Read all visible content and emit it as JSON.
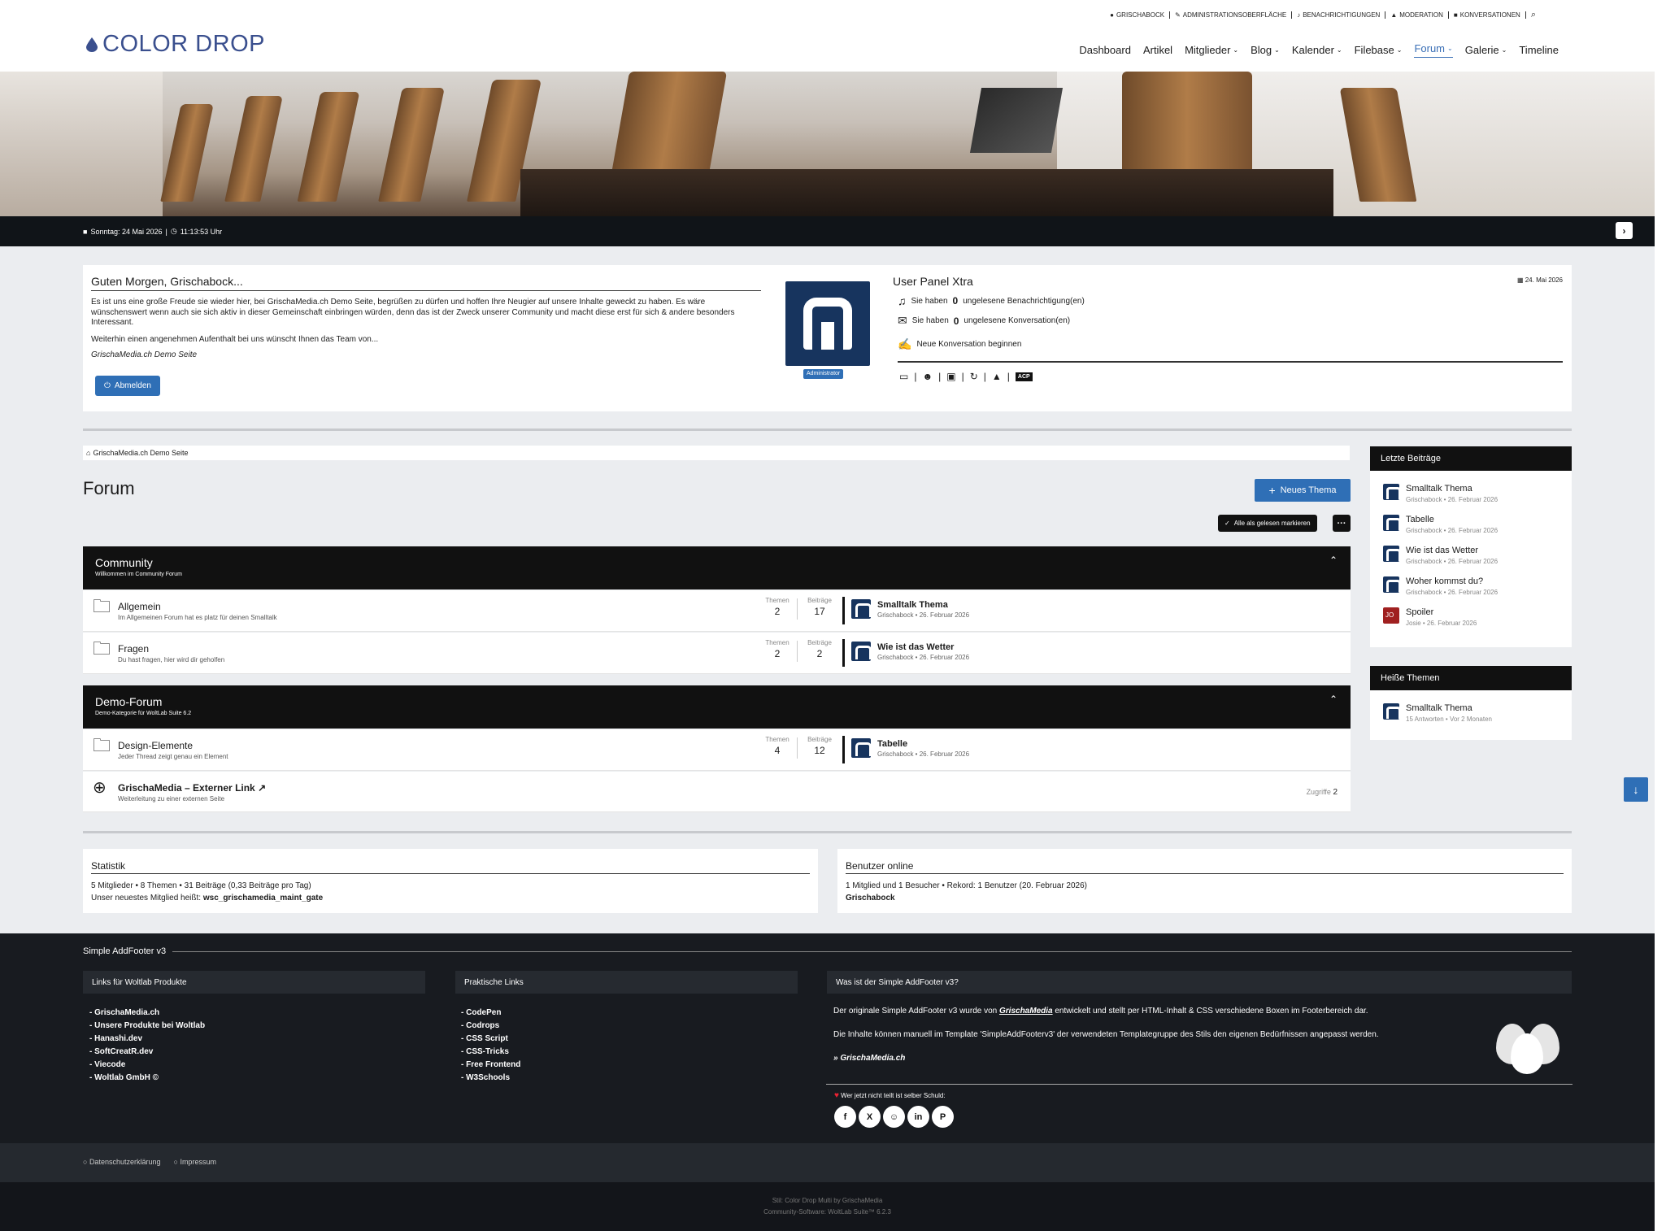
{
  "topbar": {
    "items": [
      "Grischabock",
      "Administrationsoberfläche",
      "Benachrichtigungen",
      "Moderation",
      "Konversationen"
    ]
  },
  "logo": {
    "title": "COLOR DROP"
  },
  "nav": {
    "items": [
      {
        "label": "Dashboard",
        "dropdown": false
      },
      {
        "label": "Artikel",
        "dropdown": false
      },
      {
        "label": "Mitglieder",
        "dropdown": true
      },
      {
        "label": "Blog",
        "dropdown": true
      },
      {
        "label": "Kalender",
        "dropdown": true
      },
      {
        "label": "Filebase",
        "dropdown": true
      },
      {
        "label": "Forum",
        "dropdown": true,
        "active": true
      },
      {
        "label": "Galerie",
        "dropdown": true
      },
      {
        "label": "Timeline",
        "dropdown": false
      }
    ]
  },
  "datebar": {
    "text": "Sonntag: 24 Mai 2026",
    "time": "11:13:53 Uhr"
  },
  "greeting": {
    "title": "Guten Morgen, Grischabock...",
    "p1": "Es ist uns eine große Freude sie wieder hier, bei GrischaMedia.ch Demo Seite, begrüßen zu dürfen und hoffen Ihre Neugier auf unsere Inhalte geweckt zu haben. Es wäre wünschenswert wenn auch sie sich aktiv in dieser Gemeinschaft einbringen würden, denn das ist der Zweck unserer Community und macht diese erst für sich & andere besonders Interessant.",
    "p2": "Weiterhin einen angenehmen Aufenthalt bei uns wünscht Ihnen das Team von...",
    "signature": "GrischaMedia.ch Demo Seite",
    "logout": "Abmelden"
  },
  "avatar": {
    "badge": "Administrator"
  },
  "userpanel": {
    "title": "User Panel Xtra",
    "date": "24. Mai 2026",
    "notifications": {
      "pre": "Sie haben",
      "count": "0",
      "post": "ungelesene Benachrichtigung(en)"
    },
    "conversations": {
      "pre": "Sie haben",
      "count": "0",
      "post": "ungelesene Konversation(en)"
    },
    "new_conversation": "Neue Konversation beginnen",
    "acp": "ACP"
  },
  "breadcrumb": {
    "label": "GrischaMedia.ch Demo Seite"
  },
  "forum": {
    "title": "Forum",
    "new_thread": "Neues Thema",
    "mark_read": "Alle als gelesen markieren",
    "more": "···",
    "categories": [
      {
        "title": "Community",
        "subtitle": "Willkommen im Community Forum",
        "boards": [
          {
            "title": "Allgemein",
            "desc": "Im Allgemeinen Forum hat es platz für deinen Smalltalk",
            "themen_label": "Themen",
            "themen": "2",
            "beitraege_label": "Beiträge",
            "beitraege": "17",
            "last_title": "Smalltalk Thema",
            "last_meta": "Grischabock • 26. Februar 2026"
          },
          {
            "title": "Fragen",
            "desc": "Du hast fragen, hier wird dir geholfen",
            "themen_label": "Themen",
            "themen": "2",
            "beitraege_label": "Beiträge",
            "beitraege": "2",
            "last_title": "Wie ist das Wetter",
            "last_meta": "Grischabock • 26. Februar 2026"
          }
        ]
      },
      {
        "title": "Demo-Forum",
        "subtitle": "Demo-Kategorie für WoltLab Suite 6.2",
        "boards": [
          {
            "title": "Design-Elemente",
            "desc": "Jeder Thread zeigt genau ein Element",
            "themen_label": "Themen",
            "themen": "4",
            "beitraege_label": "Beiträge",
            "beitraege": "12",
            "last_title": "Tabelle",
            "last_meta": "Grischabock • 26. Februar 2026"
          },
          {
            "title": "GrischaMedia – Externer Link ↗",
            "desc": "Weiterleitung zu einer externen Seite",
            "hits_label": "Zugriffe",
            "hits": "2"
          }
        ]
      }
    ]
  },
  "sidebar": {
    "recent_title": "Letzte Beiträge",
    "recent": [
      {
        "title": "Smalltalk Thema",
        "meta": "Grischabock • 26. Februar 2026"
      },
      {
        "title": "Tabelle",
        "meta": "Grischabock • 26. Februar 2026"
      },
      {
        "title": "Wie ist das Wetter",
        "meta": "Grischabock • 26. Februar 2026"
      },
      {
        "title": "Woher kommst du?",
        "meta": "Grischabock • 26. Februar 2026"
      },
      {
        "title": "Spoiler",
        "meta": "Josie • 26. Februar 2026"
      }
    ],
    "hot_title": "Heiße Themen",
    "hot": [
      {
        "title": "Smalltalk Thema",
        "meta": "15 Antworten • Vor 2 Monaten"
      }
    ]
  },
  "stats": {
    "title": "Statistik",
    "line1": "5 Mitglieder  •  8 Themen  •  31 Beiträge (0,33 Beiträge pro Tag)",
    "line2_pre": "Unser neuestes Mitglied heißt:",
    "newest": "wsc_grischamedia_maint_gate"
  },
  "online": {
    "title": "Benutzer online",
    "line1": "1 Mitglied und 1 Besucher  •  Rekord: 1 Benutzer (20. Februar 2026)",
    "user": "Grischabock"
  },
  "footer": {
    "title": "Simple AddFooter v3",
    "col1_title": "Links für Woltlab Produkte",
    "col1": [
      "GrischaMedia.ch",
      "Unsere Produkte bei Woltlab",
      "Hanashi.dev",
      "SoftCreatR.dev",
      "Viecode",
      "Woltlab GmbH ©"
    ],
    "col2_title": "Praktische Links",
    "col2": [
      "CodePen",
      "Codrops",
      "CSS Script",
      "CSS-Tricks",
      "Free Frontend",
      "W3Schools"
    ],
    "col3_title": "Was ist der Simple AddFooter v3?",
    "desc1_pre": "Der originale Simple AddFooter v3 wurde von",
    "desc1_brand": "GrischaMedia",
    "desc1_post": "entwickelt und stellt per HTML-Inhalt & CSS verschiedene Boxen im Footerbereich dar.",
    "desc2": "Die Inhalte können manuell im Template 'SimpleAddFooterv3' der verwendeten Templategruppe des Stils den eigenen Bedürfnissen angepasst werden.",
    "desc3": "» GrischaMedia.ch",
    "share": "Wer jetzt nicht teilt ist selber Schuld:"
  },
  "bottom": {
    "links": [
      "Datenschutzerklärung",
      "Impressum"
    ]
  },
  "copyright": {
    "line1": "Stil: Color Drop Multi by GrischaMedia",
    "line2": "Community-Software: WoltLab Suite™ 6.2.3"
  },
  "colors": {
    "accent": "#2f6fb6",
    "dark": "#111111",
    "avatar": "#17345e"
  }
}
